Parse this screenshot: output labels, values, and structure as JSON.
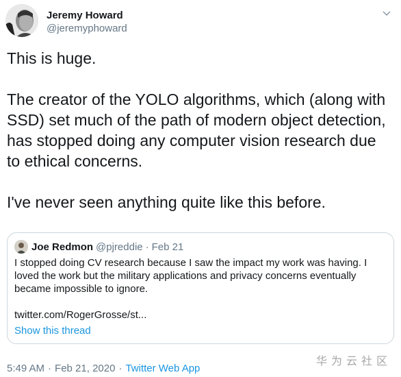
{
  "author": {
    "name": "Jeremy Howard",
    "handle": "@jeremyphoward"
  },
  "tweet": {
    "line1": "This is huge.",
    "paragraph2": "The creator of the YOLO algorithms, which (along with SSD) set much of the path of modern object detection, has stopped doing any computer vision research due to ethical concerns.",
    "line3": "I've never seen anything quite like this before."
  },
  "quote": {
    "name": "Joe Redmon",
    "handle": "@pjreddie",
    "separator": "·",
    "date": "Feb 21",
    "text": "I stopped doing CV research because I saw the impact my work was having. I loved the work but the military applications and privacy concerns eventually became impossible to ignore.",
    "link": "twitter.com/RogerGrosse/st...",
    "show_thread": "Show this thread"
  },
  "footer": {
    "time": "5:49 AM",
    "separator": "·",
    "date": "Feb 21, 2020",
    "source": "Twitter Web App"
  },
  "watermark": "华为云社区",
  "colors": {
    "text": "#14171a",
    "secondary": "#657786",
    "link": "#1b95e0",
    "border": "#ccd6dd"
  },
  "icons": {
    "menu": "chevron-down-icon"
  }
}
